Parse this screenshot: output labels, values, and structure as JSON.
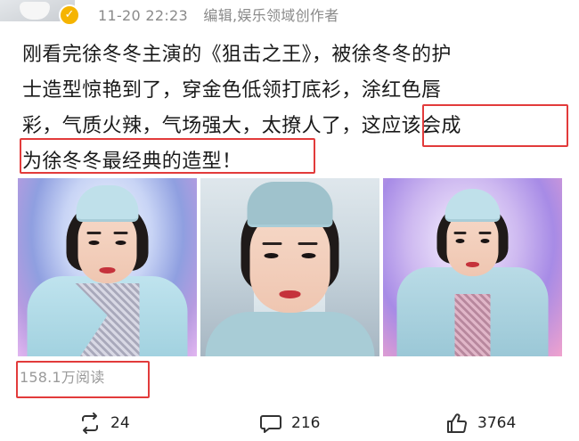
{
  "post": {
    "timestamp": "11-20 22:23",
    "edited_label": "编辑",
    "author_tag": "娱乐领域创作者",
    "text_lines": [
      "刚看完徐冬冬主演的《狙击之王》，被徐冬冬的护",
      "士造型惊艳到了，穿金色低领打底衫，涂红色唇",
      "彩，气质火辣，气场强大，太撩人了，这应该会成",
      "为徐冬冬最经典的造型！"
    ],
    "read_count": "158.1万阅读"
  },
  "actions": {
    "repost_count": "24",
    "comment_count": "216",
    "like_count": "3764"
  },
  "icons": {
    "verified": "verified-badge-icon",
    "repost": "repost-icon",
    "comment": "comment-icon",
    "like": "thumbs-up-icon"
  },
  "colors": {
    "highlight_box": "#e23b3b",
    "verified_badge": "#f5b400"
  }
}
